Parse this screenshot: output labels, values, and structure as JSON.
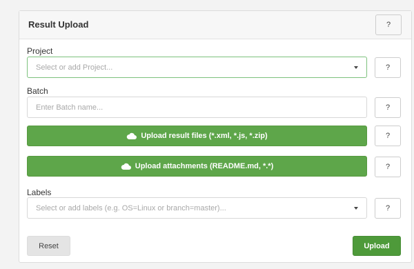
{
  "panel": {
    "title": "Result Upload",
    "help_label": "?"
  },
  "project": {
    "label": "Project",
    "placeholder": "Select or add Project...",
    "help_label": "?"
  },
  "batch": {
    "label": "Batch",
    "placeholder": "Enter Batch name...",
    "help_label": "?"
  },
  "upload_results": {
    "label": "Upload result files (*.xml, *.js, *.zip)",
    "help_label": "?",
    "icon": "cloud-icon"
  },
  "upload_attachments": {
    "label": "Upload attachments (README.md, *.*)",
    "help_label": "?",
    "icon": "cloud-icon"
  },
  "labels": {
    "label": "Labels",
    "placeholder": "Select or add labels (e.g. OS=Linux or branch=master)...",
    "help_label": "?"
  },
  "actions": {
    "reset_label": "Reset",
    "upload_label": "Upload"
  },
  "colors": {
    "accent_green": "#5ea64a",
    "focus_border": "#7cc17c",
    "reset_gray": "#e4e4e4"
  }
}
